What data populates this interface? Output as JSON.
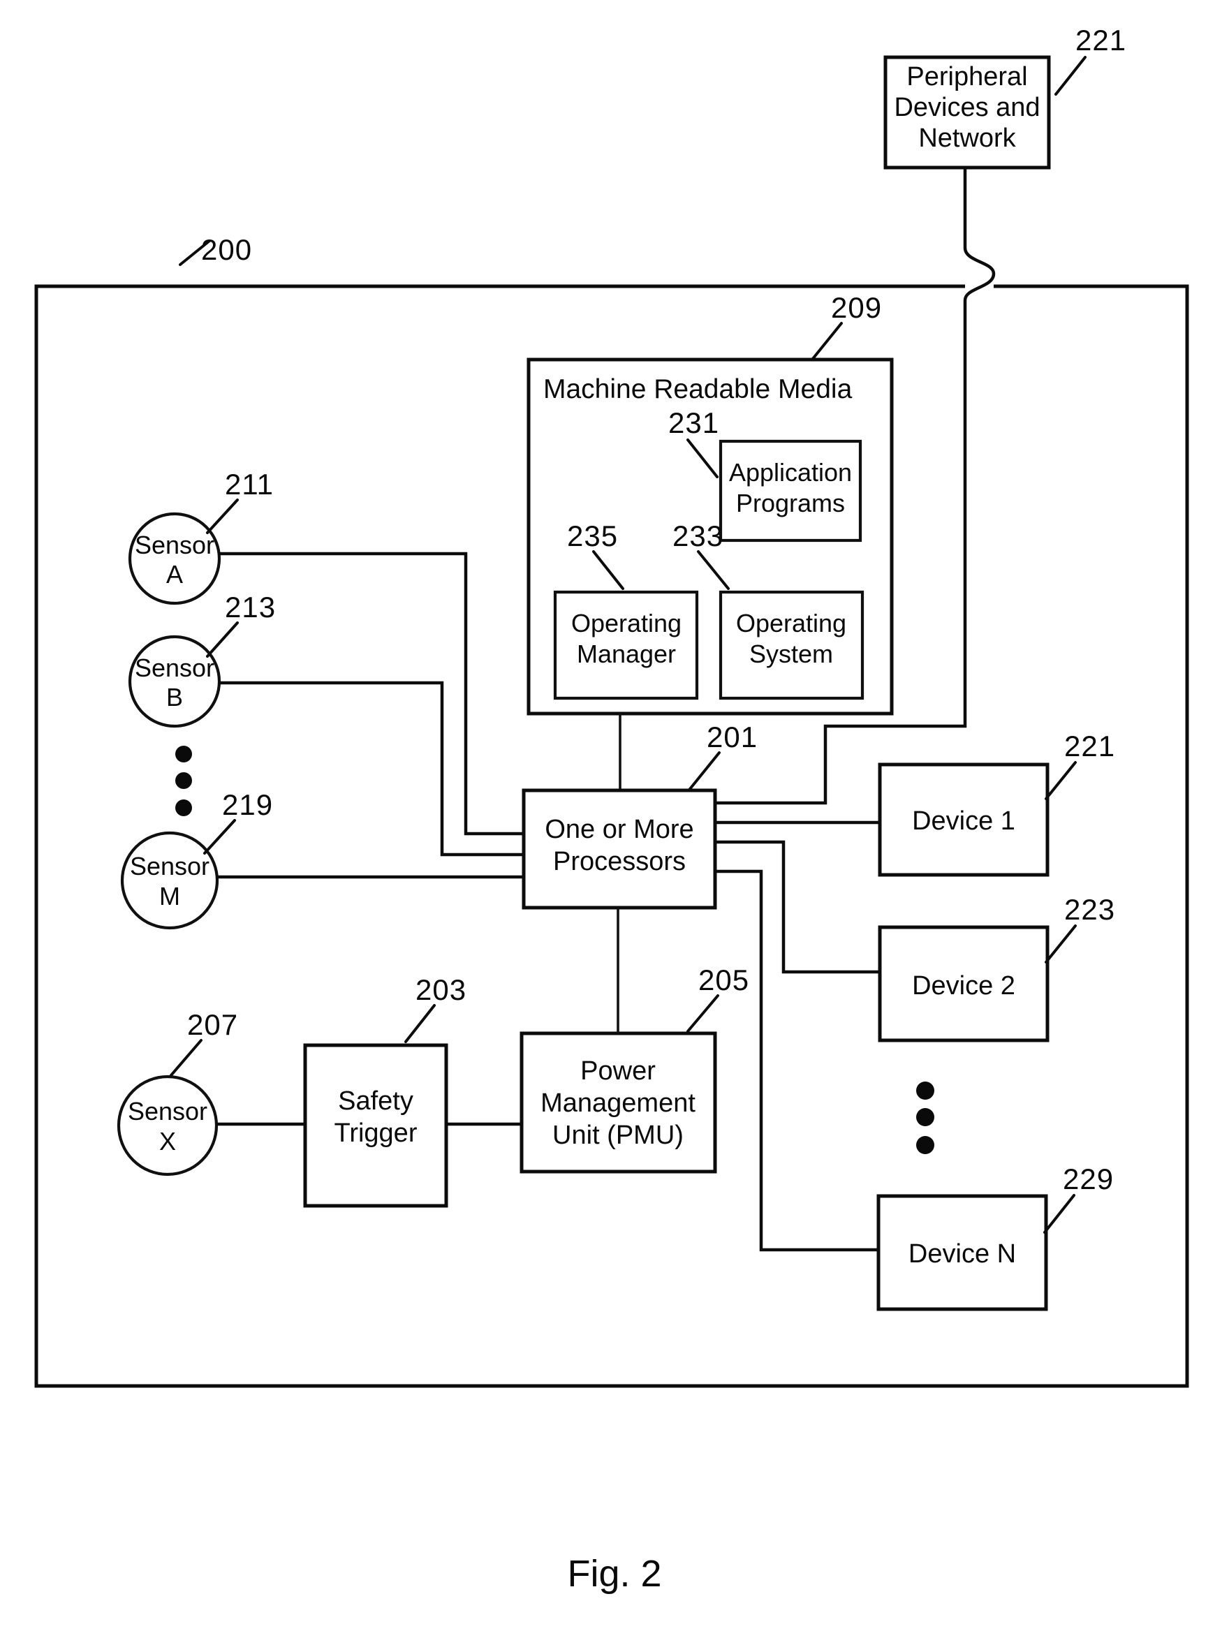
{
  "figure": {
    "caption": "Fig. 2",
    "system_ref": "200"
  },
  "peripheral": {
    "line1": "Peripheral",
    "line2": "Devices and",
    "line3": "Network",
    "ref": "221"
  },
  "machine_readable_media": {
    "title": "Machine Readable Media",
    "ref": "209",
    "modules": [
      {
        "name": "application-programs",
        "line1": "Application",
        "line2": "Programs",
        "ref": "231"
      },
      {
        "name": "operating-manager",
        "line1": "Operating",
        "line2": "Manager",
        "ref": "235"
      },
      {
        "name": "operating-system",
        "line1": "Operating",
        "line2": "System",
        "ref": "233"
      }
    ]
  },
  "processors": {
    "line1": "One or More",
    "line2": "Processors",
    "ref": "201"
  },
  "power_management_unit": {
    "line1": "Power",
    "line2": "Management",
    "line3": "Unit (PMU)",
    "ref": "205"
  },
  "safety_trigger": {
    "line1": "Safety",
    "line2": "Trigger",
    "ref": "203"
  },
  "sensors": [
    {
      "name": "sensor-a",
      "line1": "Sensor",
      "line2": "A",
      "ref": "211"
    },
    {
      "name": "sensor-b",
      "line1": "Sensor",
      "line2": "B",
      "ref": "213"
    },
    {
      "name": "sensor-m",
      "line1": "Sensor",
      "line2": "M",
      "ref": "219"
    },
    {
      "name": "sensor-x",
      "line1": "Sensor",
      "line2": "X",
      "ref": "207"
    }
  ],
  "devices": [
    {
      "name": "device-1",
      "label": "Device 1",
      "ref": "221"
    },
    {
      "name": "device-2",
      "label": "Device 2",
      "ref": "223"
    },
    {
      "name": "device-n",
      "label": "Device N",
      "ref": "229"
    }
  ],
  "colors": {
    "ink": "#0c0c0c",
    "paper": "#ffffff"
  }
}
